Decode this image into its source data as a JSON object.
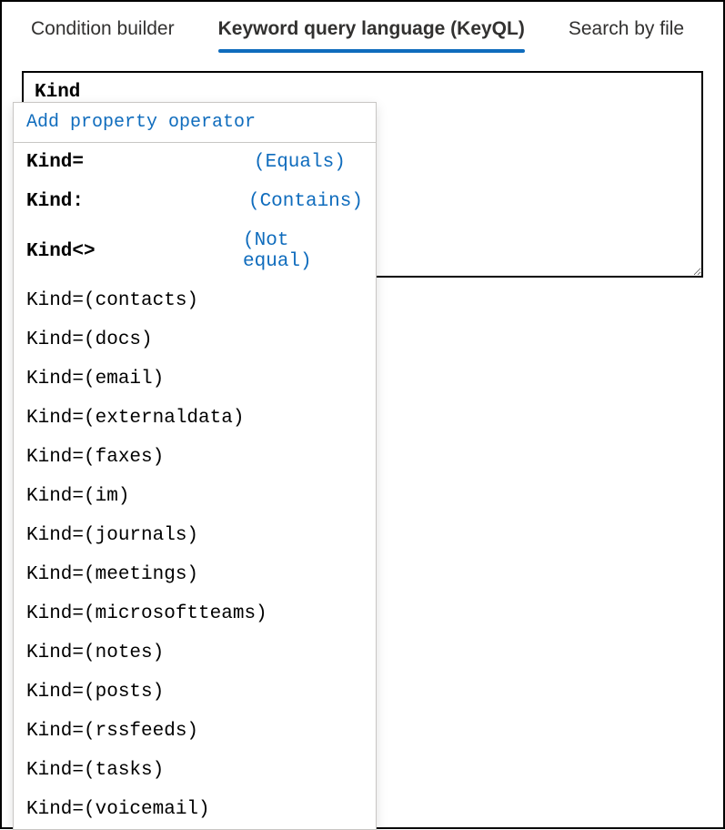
{
  "tabs": [
    {
      "label": "Condition builder",
      "active": false
    },
    {
      "label": "Keyword query language (KeyQL)",
      "active": true
    },
    {
      "label": "Search by file",
      "active": false
    }
  ],
  "query": {
    "value": "Kind"
  },
  "dropdown": {
    "header": "Add property operator",
    "operators": [
      {
        "code": "Kind=",
        "desc": "(Equals)"
      },
      {
        "code": "Kind:",
        "desc": "(Contains)"
      },
      {
        "code": "Kind<>",
        "desc": "(Not equal)"
      }
    ],
    "values": [
      "Kind=(contacts)",
      "Kind=(docs)",
      "Kind=(email)",
      "Kind=(externaldata)",
      "Kind=(faxes)",
      "Kind=(im)",
      "Kind=(journals)",
      "Kind=(meetings)",
      "Kind=(microsoftteams)",
      "Kind=(notes)",
      "Kind=(posts)",
      "Kind=(rssfeeds)",
      "Kind=(tasks)",
      "Kind=(voicemail)"
    ]
  }
}
